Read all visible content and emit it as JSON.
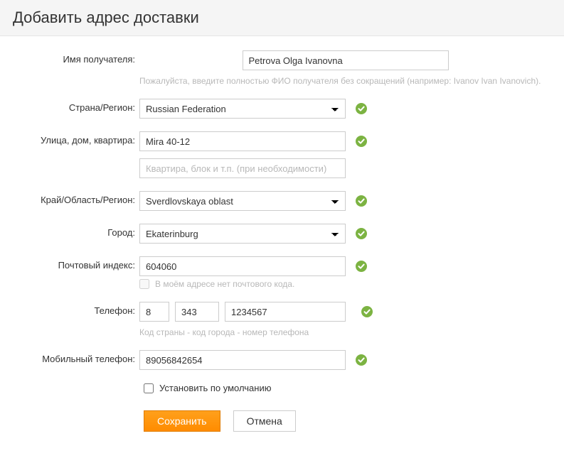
{
  "header": {
    "title": "Добавить адрес доставки"
  },
  "labels": {
    "name": "Имя получателя:",
    "country": "Страна/Регион:",
    "street": "Улица, дом, квартира:",
    "region": "Край/Область/Регион:",
    "city": "Город:",
    "zip": "Почтовый индекс:",
    "phone": "Телефон:",
    "mobile": "Мобильный телефон:"
  },
  "fields": {
    "name": {
      "value": "Petrova Olga Ivanovna",
      "hint": "Пожалуйста, введите полностью ФИО получателя без сокращений (например: Ivanov Ivan Ivanovich)."
    },
    "country": {
      "value": "Russian Federation"
    },
    "street1": {
      "value": "Mira 40-12"
    },
    "street2": {
      "value": "",
      "placeholder": "Квартира, блок и т.п. (при необходимости)"
    },
    "region": {
      "value": "Sverdlovskaya oblast"
    },
    "city": {
      "value": "Ekaterinburg"
    },
    "zip": {
      "value": "604060",
      "no_code_label": "В моём адресе нет почтового кода."
    },
    "phone": {
      "cc": "8",
      "area": "343",
      "number": "1234567",
      "hint": "Код страны - код города - номер телефона"
    },
    "mobile": {
      "value": "89056842654"
    }
  },
  "defaultCheckbox": {
    "label": "Установить по умолчанию"
  },
  "buttons": {
    "save": "Сохранить",
    "cancel": "Отмена"
  }
}
